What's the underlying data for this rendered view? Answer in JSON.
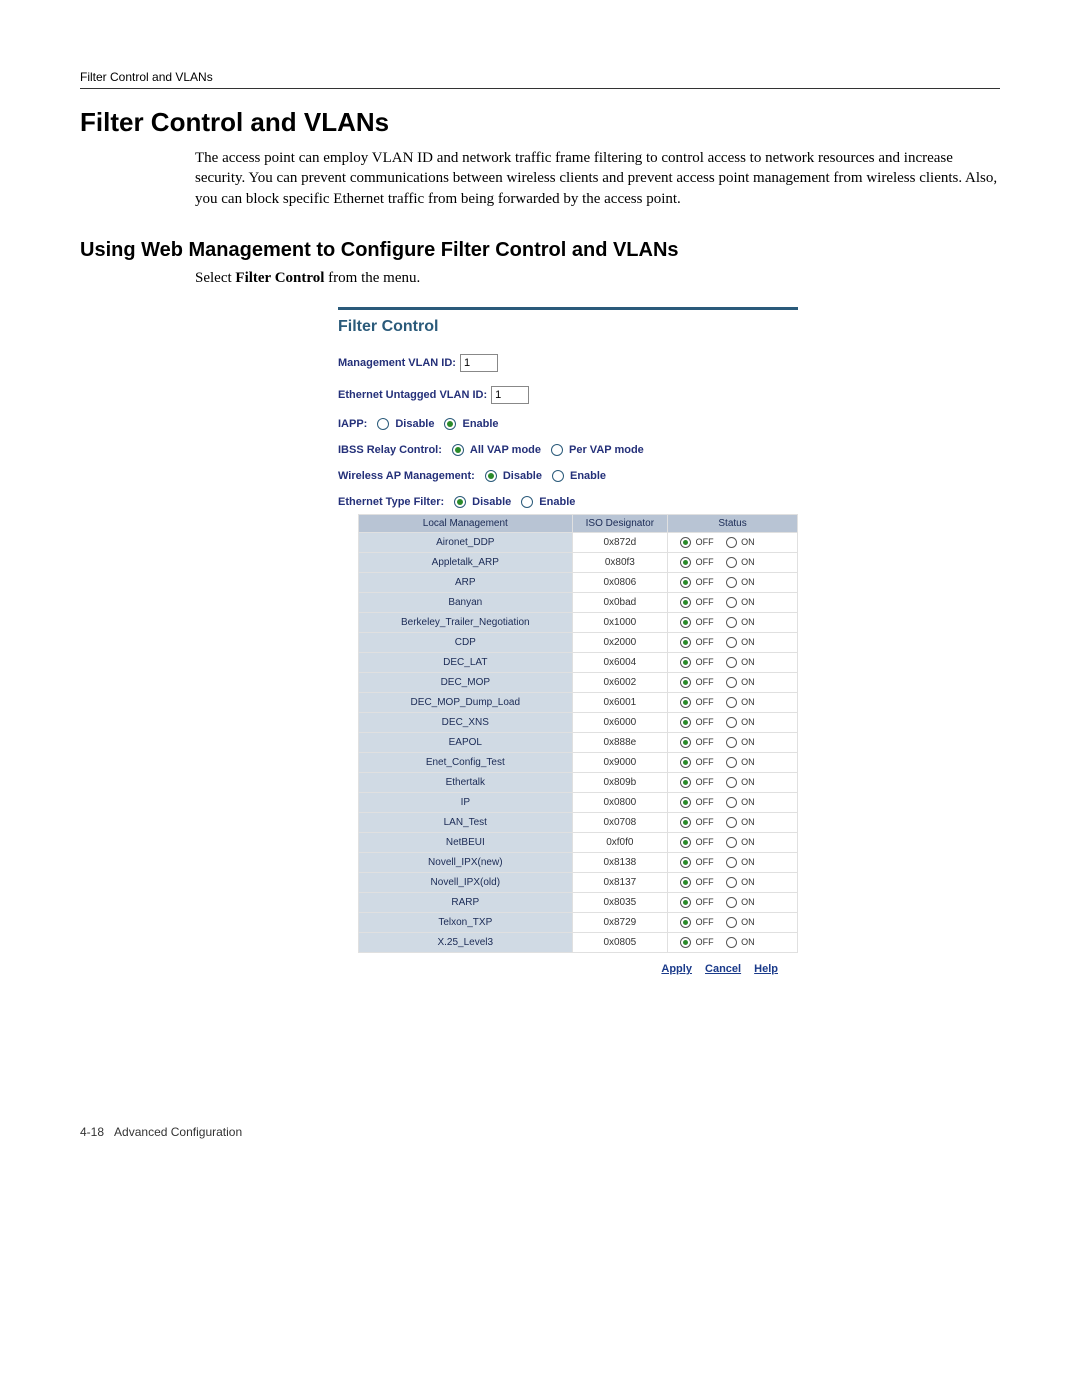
{
  "header": {
    "running_title": "Filter Control and VLANs"
  },
  "section": {
    "h1": "Filter Control and VLANs",
    "intro": "The access point can employ VLAN ID and network traffic frame filtering to control access to network resources and increase security. You can prevent communications between wireless clients and prevent access point management from wireless clients. Also, you can block specific Ethernet traffic from being forwarded by the access point.",
    "h2": "Using Web Management to Configure Filter Control and VLANs",
    "sub_intro_prefix": "Select ",
    "sub_intro_bold": "Filter Control",
    "sub_intro_suffix": " from the menu."
  },
  "filter_control": {
    "title": "Filter Control",
    "mgmt_vlan_label": "Management VLAN ID:",
    "mgmt_vlan_value": "1",
    "eth_untag_label": "Ethernet Untagged VLAN ID:",
    "eth_untag_value": "1",
    "iapp_label": "IAPP:",
    "iapp_disable": "Disable",
    "iapp_enable": "Enable",
    "ibss_label": "IBSS Relay Control:",
    "ibss_all": "All VAP mode",
    "ibss_per": "Per VAP mode",
    "wap_label": "Wireless AP Management:",
    "wap_disable": "Disable",
    "wap_enable": "Enable",
    "etf_label": "Ethernet Type Filter:",
    "etf_disable": "Disable",
    "etf_enable": "Enable",
    "table_headers": {
      "local": "Local Management",
      "iso": "ISO Designator",
      "status": "Status"
    },
    "off_label": "OFF",
    "on_label": "ON",
    "rows": [
      {
        "name": "Aironet_DDP",
        "iso": "0x872d"
      },
      {
        "name": "Appletalk_ARP",
        "iso": "0x80f3"
      },
      {
        "name": "ARP",
        "iso": "0x0806"
      },
      {
        "name": "Banyan",
        "iso": "0x0bad"
      },
      {
        "name": "Berkeley_Trailer_Negotiation",
        "iso": "0x1000"
      },
      {
        "name": "CDP",
        "iso": "0x2000"
      },
      {
        "name": "DEC_LAT",
        "iso": "0x6004"
      },
      {
        "name": "DEC_MOP",
        "iso": "0x6002"
      },
      {
        "name": "DEC_MOP_Dump_Load",
        "iso": "0x6001"
      },
      {
        "name": "DEC_XNS",
        "iso": "0x6000"
      },
      {
        "name": "EAPOL",
        "iso": "0x888e"
      },
      {
        "name": "Enet_Config_Test",
        "iso": "0x9000"
      },
      {
        "name": "Ethertalk",
        "iso": "0x809b"
      },
      {
        "name": "IP",
        "iso": "0x0800"
      },
      {
        "name": "LAN_Test",
        "iso": "0x0708"
      },
      {
        "name": "NetBEUI",
        "iso": "0xf0f0"
      },
      {
        "name": "Novell_IPX(new)",
        "iso": "0x8138"
      },
      {
        "name": "Novell_IPX(old)",
        "iso": "0x8137"
      },
      {
        "name": "RARP",
        "iso": "0x8035"
      },
      {
        "name": "Telxon_TXP",
        "iso": "0x8729"
      },
      {
        "name": "X.25_Level3",
        "iso": "0x0805"
      }
    ],
    "actions": {
      "apply": "Apply",
      "cancel": "Cancel",
      "help": "Help"
    }
  },
  "footer": {
    "page": "4-18",
    "label": "Advanced Configuration"
  }
}
